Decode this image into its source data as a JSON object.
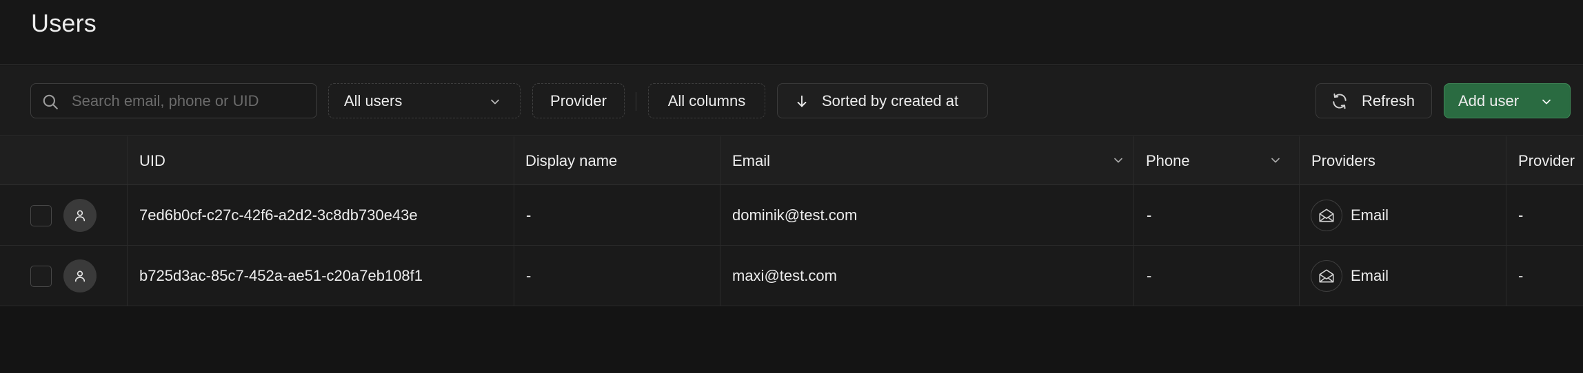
{
  "header": {
    "title": "Users"
  },
  "toolbar": {
    "search_placeholder": "Search email, phone or UID",
    "filter_users_label": "All users",
    "filter_provider_label": "Provider",
    "columns_label": "All columns",
    "sort_label": "Sorted by created at",
    "refresh_label": "Refresh",
    "add_user_label": "Add user"
  },
  "table": {
    "columns": {
      "uid": "UID",
      "display_name": "Display name",
      "email": "Email",
      "phone": "Phone",
      "providers": "Providers",
      "provider_type": "Provider"
    },
    "rows": [
      {
        "uid": "7ed6b0cf-c27c-42f6-a2d2-3c8db730e43e",
        "display_name": "-",
        "email": "dominik@test.com",
        "phone": "-",
        "provider": "Email",
        "provider_type": "-"
      },
      {
        "uid": "b725d3ac-85c7-452a-ae51-c20a7eb108f1",
        "display_name": "-",
        "email": "maxi@test.com",
        "phone": "-",
        "provider": "Email",
        "provider_type": "-"
      }
    ]
  },
  "icons": {
    "search": "search-icon",
    "chevron": "chevron-down-icon",
    "sort": "arrow-down-icon",
    "refresh": "refresh-icon",
    "avatar": "user-icon",
    "provider": "envelope-icon"
  },
  "colors": {
    "background": "#141414",
    "primary": "#2a6b41",
    "primary_border": "#3f8a58",
    "text": "#ededed",
    "muted_text": "#6b6b6b"
  }
}
